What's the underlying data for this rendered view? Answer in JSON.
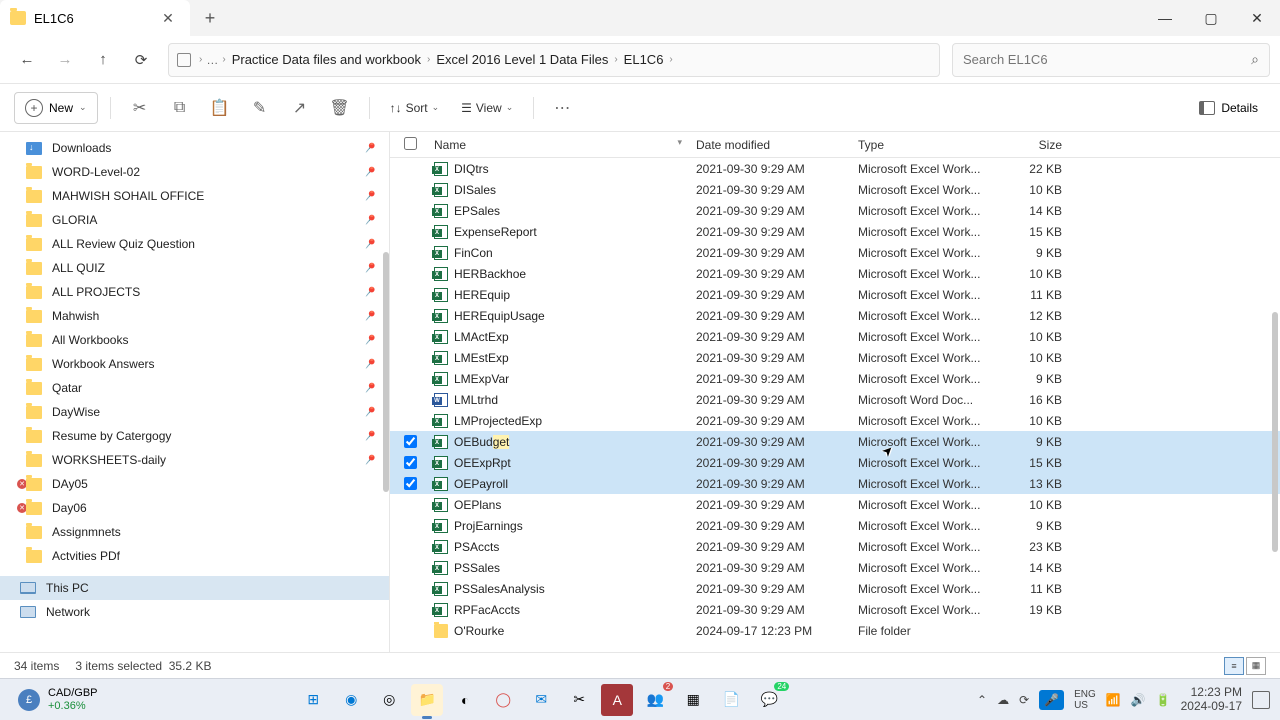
{
  "tab": {
    "title": "EL1C6"
  },
  "breadcrumb": {
    "items": [
      "Practice Data files and workbook",
      "Excel 2016 Level 1 Data Files",
      "EL1C6"
    ]
  },
  "search": {
    "placeholder": "Search EL1C6"
  },
  "toolbar": {
    "new": "New",
    "sort": "Sort",
    "view": "View",
    "details": "Details"
  },
  "sidebar": {
    "items": [
      {
        "label": "Downloads",
        "icon": "dl",
        "pinned": true
      },
      {
        "label": "WORD-Level-02",
        "icon": "f",
        "pinned": true
      },
      {
        "label": "MAHWISH SOHAIL OFFICE",
        "icon": "f",
        "pinned": true
      },
      {
        "label": "GLORIA",
        "icon": "f",
        "pinned": true
      },
      {
        "label": "ALL Review Quiz Question",
        "icon": "f",
        "pinned": true
      },
      {
        "label": "ALL QUIZ",
        "icon": "f",
        "pinned": true
      },
      {
        "label": "ALL PROJECTS",
        "icon": "f",
        "pinned": true
      },
      {
        "label": "Mahwish",
        "icon": "f",
        "pinned": true
      },
      {
        "label": "All Workbooks",
        "icon": "f",
        "pinned": true
      },
      {
        "label": "Workbook Answers",
        "icon": "f",
        "pinned": true
      },
      {
        "label": "Qatar",
        "icon": "f",
        "pinned": true
      },
      {
        "label": "DayWise",
        "icon": "f",
        "pinned": true
      },
      {
        "label": "Resume by Catergogy",
        "icon": "f",
        "pinned": true
      },
      {
        "label": "WORKSHEETS-daily",
        "icon": "f",
        "pinned": true
      },
      {
        "label": "DAy05",
        "icon": "f",
        "err": true
      },
      {
        "label": "Day06",
        "icon": "f",
        "err": true
      },
      {
        "label": "Assignmnets",
        "icon": "f"
      },
      {
        "label": "Actvities PDf",
        "icon": "f"
      }
    ],
    "thispc": "This PC",
    "network": "Network"
  },
  "columns": {
    "name": "Name",
    "date": "Date modified",
    "type": "Type",
    "size": "Size"
  },
  "files": [
    {
      "name": "DIQtrs",
      "date": "2021-09-30 9:29 AM",
      "type": "Microsoft Excel Work...",
      "size": "22 KB",
      "ico": "x"
    },
    {
      "name": "DISales",
      "date": "2021-09-30 9:29 AM",
      "type": "Microsoft Excel Work...",
      "size": "10 KB",
      "ico": "x"
    },
    {
      "name": "EPSales",
      "date": "2021-09-30 9:29 AM",
      "type": "Microsoft Excel Work...",
      "size": "14 KB",
      "ico": "x"
    },
    {
      "name": "ExpenseReport",
      "date": "2021-09-30 9:29 AM",
      "type": "Microsoft Excel Work...",
      "size": "15 KB",
      "ico": "x"
    },
    {
      "name": "FinCon",
      "date": "2021-09-30 9:29 AM",
      "type": "Microsoft Excel Work...",
      "size": "9 KB",
      "ico": "x"
    },
    {
      "name": "HERBackhoe",
      "date": "2021-09-30 9:29 AM",
      "type": "Microsoft Excel Work...",
      "size": "10 KB",
      "ico": "x"
    },
    {
      "name": "HEREquip",
      "date": "2021-09-30 9:29 AM",
      "type": "Microsoft Excel Work...",
      "size": "11 KB",
      "ico": "x"
    },
    {
      "name": "HEREquipUsage",
      "date": "2021-09-30 9:29 AM",
      "type": "Microsoft Excel Work...",
      "size": "12 KB",
      "ico": "x"
    },
    {
      "name": "LMActExp",
      "date": "2021-09-30 9:29 AM",
      "type": "Microsoft Excel Work...",
      "size": "10 KB",
      "ico": "x"
    },
    {
      "name": "LMEstExp",
      "date": "2021-09-30 9:29 AM",
      "type": "Microsoft Excel Work...",
      "size": "10 KB",
      "ico": "x"
    },
    {
      "name": "LMExpVar",
      "date": "2021-09-30 9:29 AM",
      "type": "Microsoft Excel Work...",
      "size": "9 KB",
      "ico": "x"
    },
    {
      "name": "LMLtrhd",
      "date": "2021-09-30 9:29 AM",
      "type": "Microsoft Word Doc...",
      "size": "16 KB",
      "ico": "w"
    },
    {
      "name": "LMProjectedExp",
      "date": "2021-09-30 9:29 AM",
      "type": "Microsoft Excel Work...",
      "size": "10 KB",
      "ico": "x"
    },
    {
      "name": "OEBudget",
      "date": "2021-09-30 9:29 AM",
      "type": "Microsoft Excel Work...",
      "size": "9 KB",
      "ico": "x",
      "sel": true,
      "hl": true
    },
    {
      "name": "OEExpRpt",
      "date": "2021-09-30 9:29 AM",
      "type": "Microsoft Excel Work...",
      "size": "15 KB",
      "ico": "x",
      "sel": true
    },
    {
      "name": "OEPayroll",
      "date": "2021-09-30 9:29 AM",
      "type": "Microsoft Excel Work...",
      "size": "13 KB",
      "ico": "x",
      "sel": true
    },
    {
      "name": "OEPlans",
      "date": "2021-09-30 9:29 AM",
      "type": "Microsoft Excel Work...",
      "size": "10 KB",
      "ico": "x"
    },
    {
      "name": "ProjEarnings",
      "date": "2021-09-30 9:29 AM",
      "type": "Microsoft Excel Work...",
      "size": "9 KB",
      "ico": "x"
    },
    {
      "name": "PSAccts",
      "date": "2021-09-30 9:29 AM",
      "type": "Microsoft Excel Work...",
      "size": "23 KB",
      "ico": "x"
    },
    {
      "name": "PSSales",
      "date": "2021-09-30 9:29 AM",
      "type": "Microsoft Excel Work...",
      "size": "14 KB",
      "ico": "x"
    },
    {
      "name": "PSSalesAnalysis",
      "date": "2021-09-30 9:29 AM",
      "type": "Microsoft Excel Work...",
      "size": "11 KB",
      "ico": "x"
    },
    {
      "name": "RPFacAccts",
      "date": "2021-09-30 9:29 AM",
      "type": "Microsoft Excel Work...",
      "size": "19 KB",
      "ico": "x"
    },
    {
      "name": "O'Rourke",
      "date": "2024-09-17 12:23 PM",
      "type": "File folder",
      "size": "",
      "ico": "f"
    }
  ],
  "status": {
    "items": "34 items",
    "selected": "3 items selected",
    "size": "35.2 KB"
  },
  "widget": {
    "pair": "CAD/GBP",
    "change": "+0.36%"
  },
  "clock": {
    "time": "12:23 PM",
    "date": "2024-09-17"
  },
  "badges": {
    "teams": "2",
    "wa": "24"
  }
}
